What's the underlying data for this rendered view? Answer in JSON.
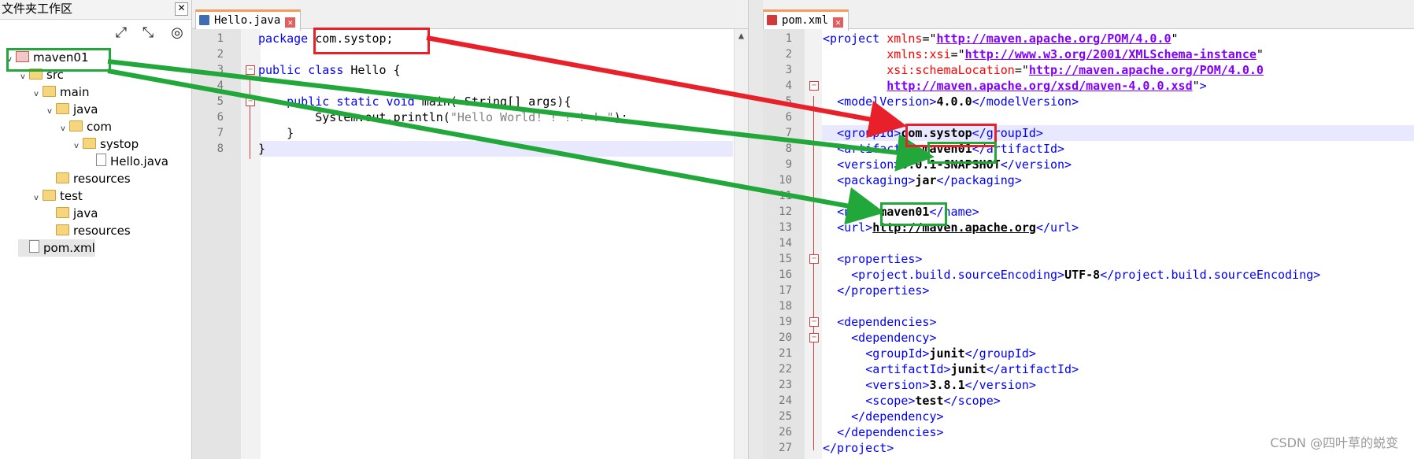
{
  "sidebar": {
    "title": "文件夹工作区",
    "close_glyph": "✕",
    "tree": [
      {
        "label": "maven01",
        "icon": "project",
        "level": 0,
        "toggle": "v"
      },
      {
        "label": "src",
        "icon": "folder",
        "level": 1,
        "toggle": "v"
      },
      {
        "label": "main",
        "icon": "folder",
        "level": 2,
        "toggle": "v"
      },
      {
        "label": "java",
        "icon": "folder",
        "level": 3,
        "toggle": "v"
      },
      {
        "label": "com",
        "icon": "folder",
        "level": 4,
        "toggle": "v"
      },
      {
        "label": "systop",
        "icon": "folder",
        "level": 5,
        "toggle": "v"
      },
      {
        "label": "Hello.java",
        "icon": "file",
        "level": 6,
        "toggle": ""
      },
      {
        "label": "resources",
        "icon": "folder",
        "level": 3,
        "toggle": ""
      },
      {
        "label": "test",
        "icon": "folder",
        "level": 2,
        "toggle": "v"
      },
      {
        "label": "java",
        "icon": "folder",
        "level": 3,
        "toggle": ""
      },
      {
        "label": "resources",
        "icon": "folder",
        "level": 3,
        "toggle": ""
      },
      {
        "label": "pom.xml",
        "icon": "file",
        "level": 1,
        "toggle": ""
      }
    ]
  },
  "left_editor": {
    "tab_label": "Hello.java",
    "tab_close": "✕",
    "lines": [
      {
        "n": "1",
        "html": "<span class='kw'>package</span> com.systop;"
      },
      {
        "n": "2",
        "html": ""
      },
      {
        "n": "3",
        "html": "<span class='kw'>public class</span> Hello {"
      },
      {
        "n": "4",
        "html": ""
      },
      {
        "n": "5",
        "html": "    <span class='kw'>public static void</span> main( String[] args){"
      },
      {
        "n": "6",
        "html": "        System.out.println(<span class='st'>\"Hello World! ! ! ! ! \"</span>);"
      },
      {
        "n": "7",
        "html": "    }"
      },
      {
        "n": "8",
        "html": "}"
      }
    ]
  },
  "right_editor": {
    "tab_label": "pom.xml",
    "tab_close": "✕",
    "lines": [
      {
        "n": "1",
        "html": "<span class='tg'>&lt;project</span> <span class='at'>xmlns</span>=\"<span class='av'>http://maven.apache.org/POM/4.0.0</span>\""
      },
      {
        "n": "2",
        "html": "         <span class='at'>xmlns:xsi</span>=\"<span class='av'>http://www.w3.org/2001/XMLSchema-instance</span>\""
      },
      {
        "n": "3",
        "html": "         <span class='at'>xsi:schemaLocation</span>=\"<span class='av'>http://maven.apache.org/POM/4.0.0</span>"
      },
      {
        "n": "4",
        "html": "         <span class='av'>http://maven.apache.org/xsd/maven-4.0.0.xsd</span>\"<span class='tg'>&gt;</span>"
      },
      {
        "n": "5",
        "html": "  <span class='tg'>&lt;modelVersion&gt;</span><span class='bd'>4.0.0</span><span class='tg'>&lt;/modelVersion&gt;</span>"
      },
      {
        "n": "6",
        "html": ""
      },
      {
        "n": "7",
        "html": "  <span class='tg'>&lt;groupId&gt;</span><span class='bd'>com.systop</span><span class='tg'>&lt;/groupId&gt;</span>"
      },
      {
        "n": "8",
        "html": "  <span class='tg'>&lt;artifactId&gt;</span><span class='bd'>maven01</span><span class='tg'>&lt;/artifactId&gt;</span>"
      },
      {
        "n": "9",
        "html": "  <span class='tg'>&lt;version&gt;</span><span class='bd'>0.0.1-SNAPSHOT</span><span class='tg'>&lt;/version&gt;</span>"
      },
      {
        "n": "10",
        "html": "  <span class='tg'>&lt;packaging&gt;</span><span class='bd'>jar</span><span class='tg'>&lt;/packaging&gt;</span>"
      },
      {
        "n": "11",
        "html": ""
      },
      {
        "n": "12",
        "html": "  <span class='tg'>&lt;name&gt;</span><span class='bd'>maven01</span><span class='tg'>&lt;/name&gt;</span>"
      },
      {
        "n": "13",
        "html": "  <span class='tg'>&lt;url&gt;</span><span class='bd' style='text-decoration:underline'>http://maven.apache.org</span><span class='tg'>&lt;/url&gt;</span>"
      },
      {
        "n": "14",
        "html": ""
      },
      {
        "n": "15",
        "html": "  <span class='tg'>&lt;properties&gt;</span>"
      },
      {
        "n": "16",
        "html": "    <span class='tg'>&lt;project.build.sourceEncoding&gt;</span><span class='bd'>UTF-8</span><span class='tg'>&lt;/project.build.sourceEncoding&gt;</span>"
      },
      {
        "n": "17",
        "html": "  <span class='tg'>&lt;/properties&gt;</span>"
      },
      {
        "n": "18",
        "html": ""
      },
      {
        "n": "19",
        "html": "  <span class='tg'>&lt;dependencies&gt;</span>"
      },
      {
        "n": "20",
        "html": "    <span class='tg'>&lt;dependency&gt;</span>"
      },
      {
        "n": "21",
        "html": "      <span class='tg'>&lt;groupId&gt;</span><span class='bd'>junit</span><span class='tg'>&lt;/groupId&gt;</span>"
      },
      {
        "n": "22",
        "html": "      <span class='tg'>&lt;artifactId&gt;</span><span class='bd'>junit</span><span class='tg'>&lt;/artifactId&gt;</span>"
      },
      {
        "n": "23",
        "html": "      <span class='tg'>&lt;version&gt;</span><span class='bd'>3.8.1</span><span class='tg'>&lt;/version&gt;</span>"
      },
      {
        "n": "24",
        "html": "      <span class='tg'>&lt;scope&gt;</span><span class='bd'>test</span><span class='tg'>&lt;/scope&gt;</span>"
      },
      {
        "n": "25",
        "html": "    <span class='tg'>&lt;/dependency&gt;</span>"
      },
      {
        "n": "26",
        "html": "  <span class='tg'>&lt;/dependencies&gt;</span>"
      },
      {
        "n": "27",
        "html": "<span class='tg'>&lt;/project&gt;</span>"
      }
    ]
  },
  "watermark": "CSDN @四叶草的蜕变",
  "colors": {
    "red_annotation": "#e8202a",
    "green_annotation": "#22a83a"
  }
}
